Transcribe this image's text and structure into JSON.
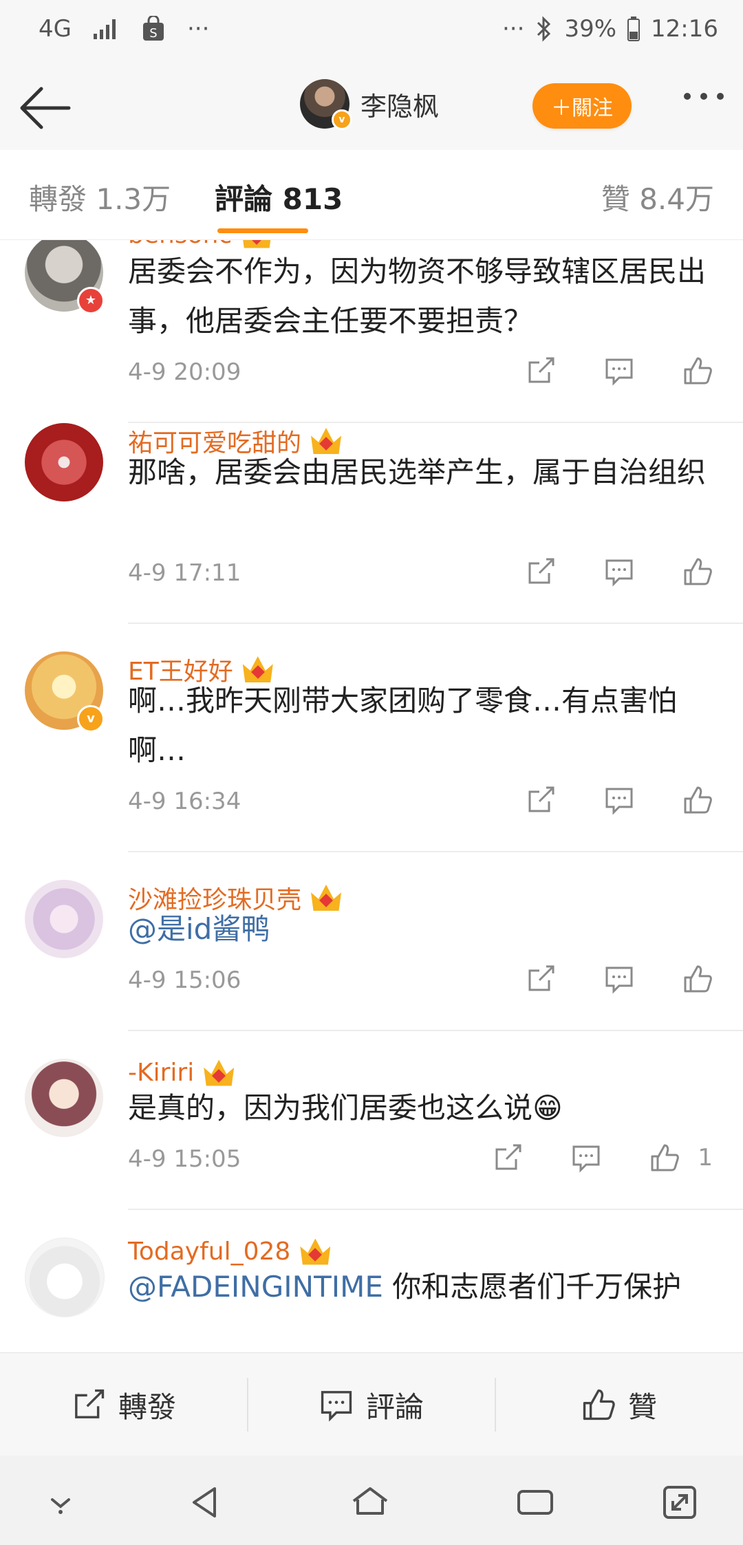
{
  "status": {
    "network": "4G",
    "more": "···",
    "more_right": "···",
    "battery": "39%",
    "time": "12:16"
  },
  "header": {
    "author_name": "李隐枫",
    "follow_label": "＋關注"
  },
  "tabs": {
    "forward": "轉發 1.3万",
    "comments": "評論 813",
    "likes": "贊 8.4万"
  },
  "comments": [
    {
      "username": "bensonc",
      "text": "居委会不作为，因为物资不够导致辖区居民出事，他居委会主任要不要担责？",
      "time": "4-9 20:09",
      "likes": ""
    },
    {
      "username": "祐可可爱吃甜的",
      "text": "那啥，居委会由居民选举产生，属于自治组织",
      "time": "4-9 17:11",
      "likes": ""
    },
    {
      "username": "ET王好好",
      "text": "啊…我昨天刚带大家团购了零食…有点害怕啊…",
      "time": "4-9 16:34",
      "likes": ""
    },
    {
      "username": "沙滩捡珍珠贝壳",
      "mention": "@是id酱鸭",
      "text": "",
      "time": "4-9 15:06",
      "likes": ""
    },
    {
      "username": "-Kiriri",
      "text": "是真的，因为我们居委也这么说😁",
      "time": "4-9 15:05",
      "likes": "1"
    },
    {
      "username": "Todayful_028",
      "mention": "@FADEINGINTIME",
      "text": " 你和志愿者们千万保护",
      "time": "",
      "likes": ""
    }
  ],
  "actionbar": {
    "forward": "轉發",
    "comment": "評論",
    "like": "贊"
  },
  "colors": {
    "accent": "#ff8d0f",
    "username": "#e36b22",
    "mention": "#3f6ea5"
  },
  "icons": [
    "back-arrow-icon",
    "share-icon",
    "comment-icon",
    "thumbs-up-icon",
    "crown-icon",
    "verified-icon",
    "bluetooth-icon",
    "battery-icon"
  ]
}
